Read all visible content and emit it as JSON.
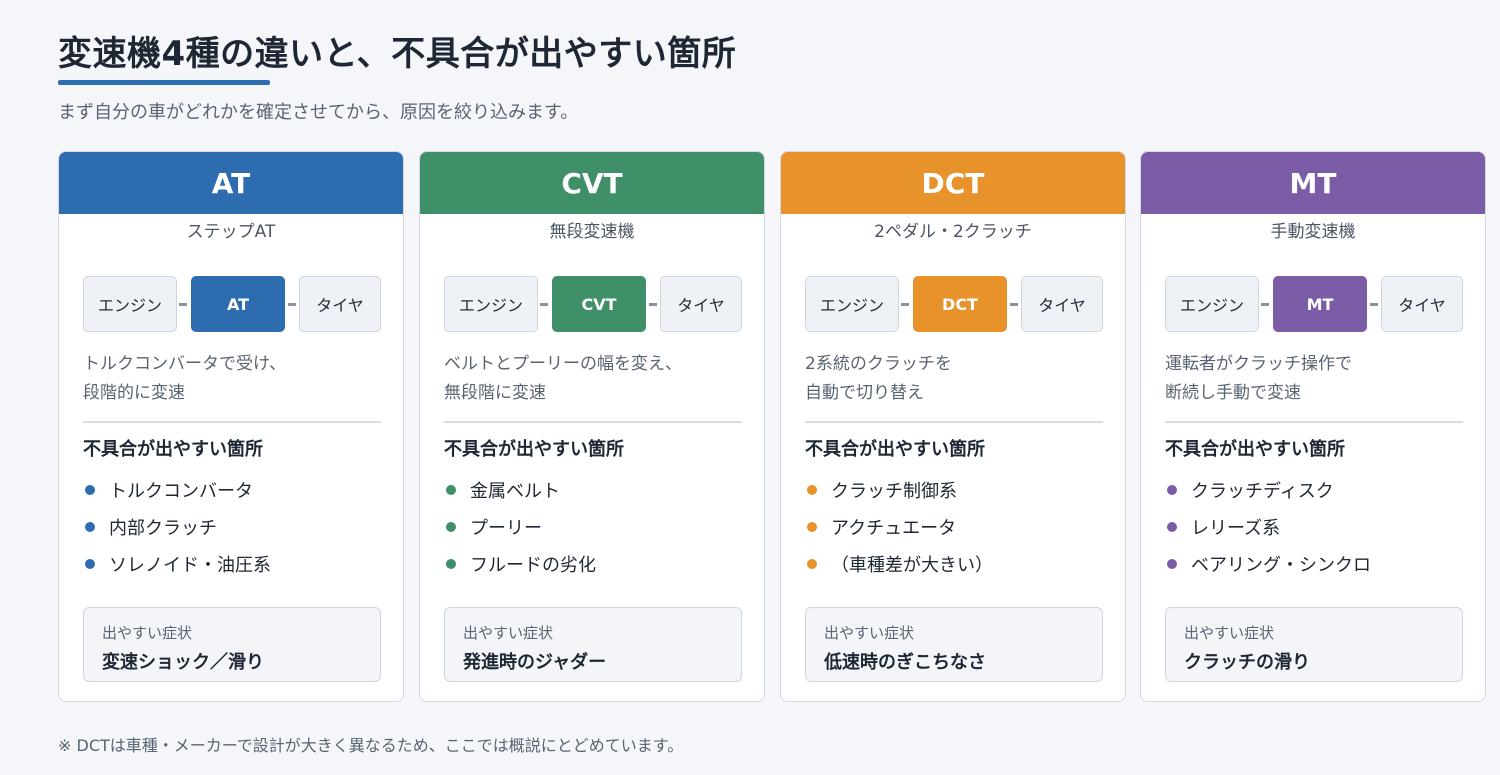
{
  "title": "変速機4種の違いと、不具合が出やすい箇所",
  "subtitle": "まず自分の車がどれかを確定させてから、原因を絞り込みます。",
  "footnote": "※ DCTは車種・メーカーで設計が大きく異なるため、ここでは概説にとどめています。",
  "colors": {
    "AT": "#2e6cb0",
    "CVT": "#3f8f68",
    "DCT": "#e8922c",
    "MT": "#7b5ca6"
  },
  "cards": [
    {
      "name": "AT",
      "subname": "ステップAT",
      "flow": {
        "left": "エンジン",
        "middle": "AT",
        "right": "タイヤ"
      },
      "desc": [
        "トルクコンバータで受け、",
        "段階的に変速"
      ],
      "issues_title": "不具合が出やすい箇所",
      "issues": [
        "トルクコンバータ",
        "内部クラッチ",
        "ソレノイド・油圧系"
      ],
      "symptom_label": "出やすい症状",
      "symptom": "変速ショック／滑り"
    },
    {
      "name": "CVT",
      "subname": "無段変速機",
      "flow": {
        "left": "エンジン",
        "middle": "CVT",
        "right": "タイヤ"
      },
      "desc": [
        "ベルトとプーリーの幅を変え、",
        "無段階に変速"
      ],
      "issues_title": "不具合が出やすい箇所",
      "issues": [
        "金属ベルト",
        "プーリー",
        "フルードの劣化"
      ],
      "symptom_label": "出やすい症状",
      "symptom": "発進時のジャダー"
    },
    {
      "name": "DCT",
      "subname": "2ペダル・2クラッチ",
      "flow": {
        "left": "エンジン",
        "middle": "DCT",
        "right": "タイヤ"
      },
      "desc": [
        "2系統のクラッチを",
        "自動で切り替え"
      ],
      "issues_title": "不具合が出やすい箇所",
      "issues": [
        "クラッチ制御系",
        "アクチュエータ",
        "（車種差が大きい）"
      ],
      "symptom_label": "出やすい症状",
      "symptom": "低速時のぎこちなさ"
    },
    {
      "name": "MT",
      "subname": "手動変速機",
      "flow": {
        "left": "エンジン",
        "middle": "MT",
        "right": "タイヤ"
      },
      "desc": [
        "運転者がクラッチ操作で",
        "断続し手動で変速"
      ],
      "issues_title": "不具合が出やすい箇所",
      "issues": [
        "クラッチディスク",
        "レリーズ系",
        "ベアリング・シンクロ"
      ],
      "symptom_label": "出やすい症状",
      "symptom": "クラッチの滑り"
    }
  ]
}
